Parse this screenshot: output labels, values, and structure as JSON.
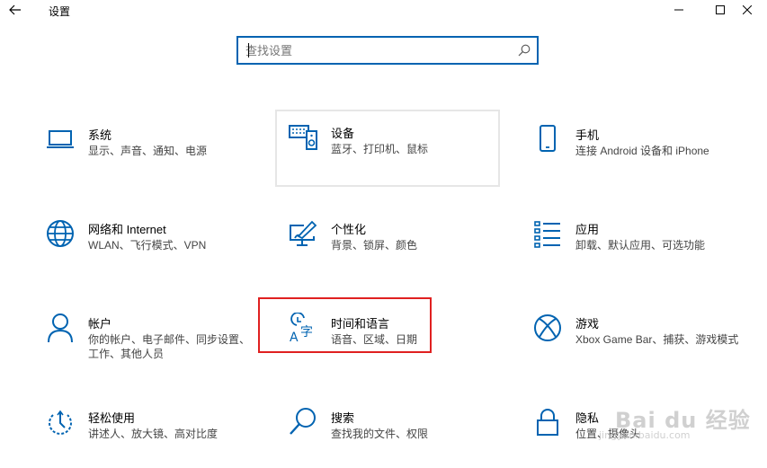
{
  "window": {
    "title": "设置"
  },
  "search": {
    "placeholder": "查找设置",
    "icon": "search-icon"
  },
  "accent_color": "#0063b1",
  "highlight_color": "#e02020",
  "tiles": [
    {
      "title": "系统",
      "desc": "显示、声音、通知、电源",
      "icon": "laptop-icon"
    },
    {
      "title": "设备",
      "desc": "蓝牙、打印机、鼠标",
      "icon": "keyboard-speaker-icon"
    },
    {
      "title": "手机",
      "desc": "连接 Android 设备和 iPhone",
      "icon": "phone-icon"
    },
    {
      "title": "网络和 Internet",
      "desc": "WLAN、飞行模式、VPN",
      "icon": "globe-icon"
    },
    {
      "title": "个性化",
      "desc": "背景、锁屏、颜色",
      "icon": "paint-monitor-icon"
    },
    {
      "title": "应用",
      "desc": "卸载、默认应用、可选功能",
      "icon": "app-list-icon"
    },
    {
      "title": "帐户",
      "desc": "你的帐户、电子邮件、同步设置、工作、其他人员",
      "icon": "person-icon"
    },
    {
      "title": "时间和语言",
      "desc": "语音、区域、日期",
      "icon": "time-language-icon"
    },
    {
      "title": "游戏",
      "desc": "Xbox Game Bar、捕获、游戏模式",
      "icon": "xbox-icon"
    },
    {
      "title": "轻松使用",
      "desc": "讲述人、放大镜、高对比度",
      "icon": "ease-of-access-icon"
    },
    {
      "title": "搜索",
      "desc": "查找我的文件、权限",
      "icon": "search-icon"
    },
    {
      "title": "隐私",
      "desc": "位置、摄像头",
      "icon": "lock-icon"
    }
  ],
  "watermark": {
    "main": "Bai du 经验",
    "sub": "jingyan.baidu.com"
  }
}
